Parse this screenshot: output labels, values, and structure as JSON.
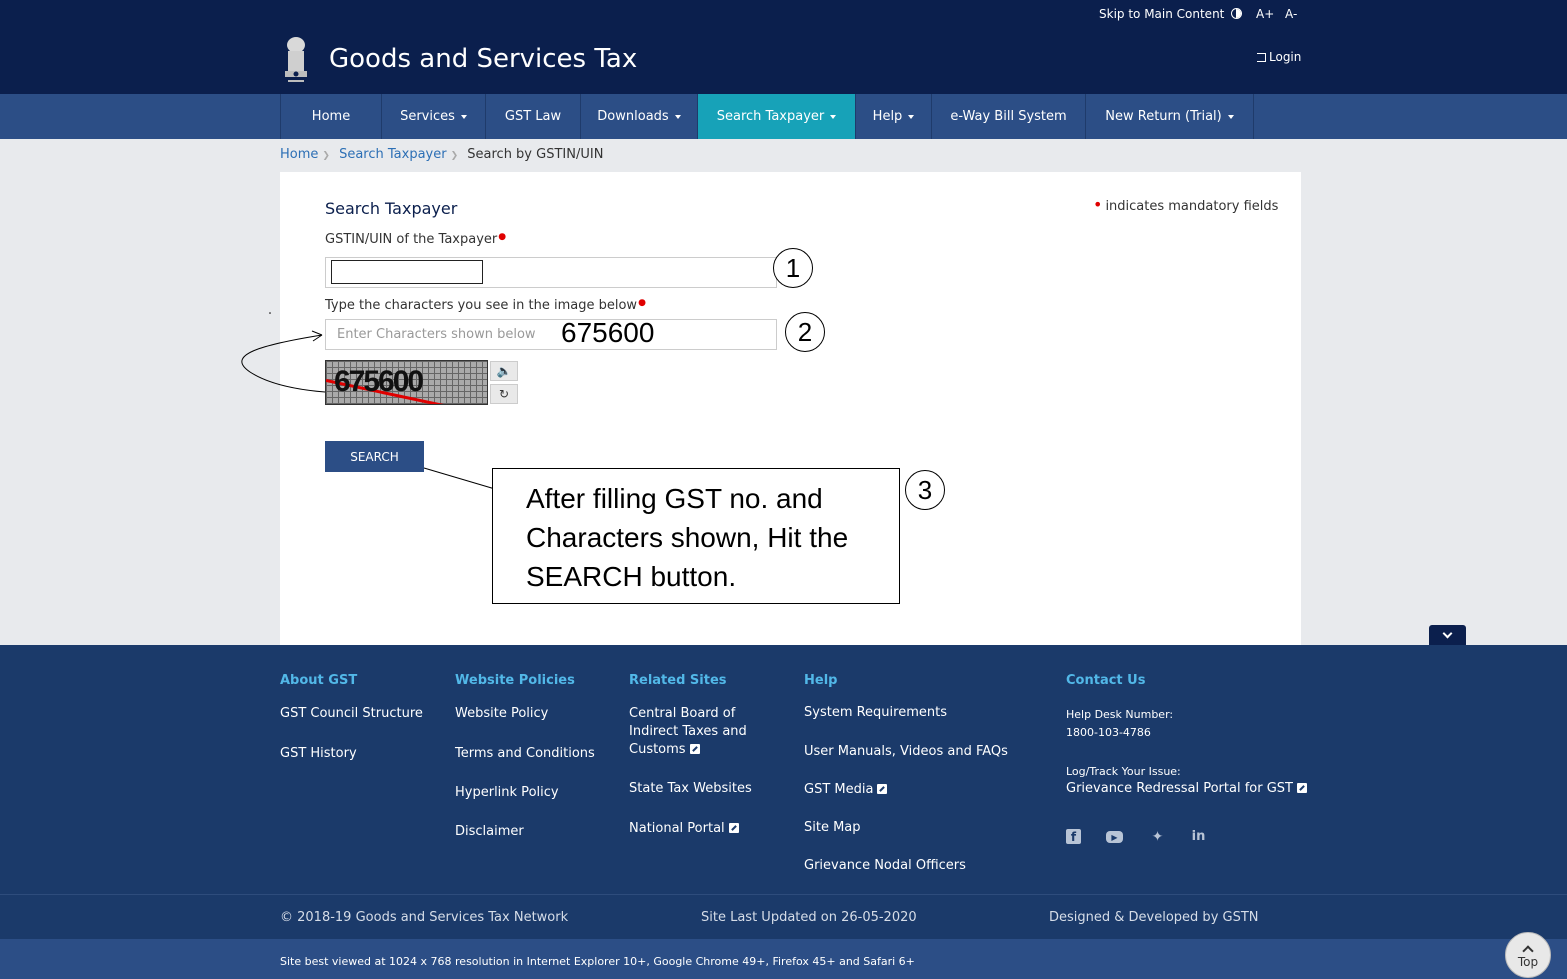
{
  "topbar": {
    "skip": "Skip to Main Content",
    "font_up": "A+",
    "font_down": "A-"
  },
  "header": {
    "title": "Goods and Services Tax",
    "login": "Login"
  },
  "nav": {
    "home": "Home",
    "services": "Services",
    "gst_law": "GST Law",
    "downloads": "Downloads",
    "search_taxpayer": "Search Taxpayer",
    "help": "Help",
    "eway": "e-Way Bill System",
    "new_return": "New Return (Trial)"
  },
  "breadcrumb": {
    "home": "Home",
    "search_taxpayer": "Search Taxpayer",
    "current": "Search by GSTIN/UIN"
  },
  "form": {
    "title": "Search Taxpayer",
    "mandatory_note": "indicates mandatory fields",
    "gstin_label": "GSTIN/UIN of the Taxpayer",
    "captcha_label": "Type the characters you see in the image below",
    "captcha_placeholder": "Enter Characters shown below",
    "captcha_typed": "675600",
    "captcha_image_text": "675600",
    "search_button": "SEARCH"
  },
  "annotations": {
    "step1": "1",
    "step2": "2",
    "step3": "3",
    "callout": "After filling GST no. and Characters shown, Hit the SEARCH button."
  },
  "footer": {
    "about": {
      "title": "About GST",
      "links": [
        "GST Council Structure",
        "GST History"
      ]
    },
    "policies": {
      "title": "Website Policies",
      "links": [
        "Website Policy",
        "Terms and Conditions",
        "Hyperlink Policy",
        "Disclaimer"
      ]
    },
    "related": {
      "title": "Related Sites",
      "cbic": "Central Board of Indirect Taxes and Customs",
      "state": "State Tax Websites",
      "national": "National Portal"
    },
    "help": {
      "title": "Help",
      "links": [
        "System Requirements",
        "User Manuals, Videos and FAQs",
        "GST Media",
        "Site Map",
        "Grievance Nodal Officers"
      ]
    },
    "contact": {
      "title": "Contact Us",
      "helpdesk_label": "Help Desk Number:",
      "helpdesk_number": "1800-103-4786",
      "track_label": "Log/Track Your Issue:",
      "grievance": "Grievance Redressal Portal for GST"
    },
    "social": [
      "facebook-icon",
      "youtube-icon",
      "twitter-icon",
      "linkedin-icon"
    ]
  },
  "copyright": {
    "left": "© 2018-19 Goods and Services Tax Network",
    "middle": "Site Last Updated on 26-05-2020",
    "right": "Designed & Developed by GSTN"
  },
  "bottombar": {
    "text": "Site best viewed at 1024 x 768 resolution in Internet Explorer 10+, Google Chrome 49+, Firefox 45+ and Safari 6+"
  },
  "top_button": "Top",
  "colors": {
    "header_navy": "#0b1f4d",
    "nav_blue": "#2c4e86",
    "active_teal": "#17a2b8",
    "footer_blue": "#1b3a6a",
    "footer_heading": "#52b8e8",
    "mandatory_red": "#e00000"
  }
}
